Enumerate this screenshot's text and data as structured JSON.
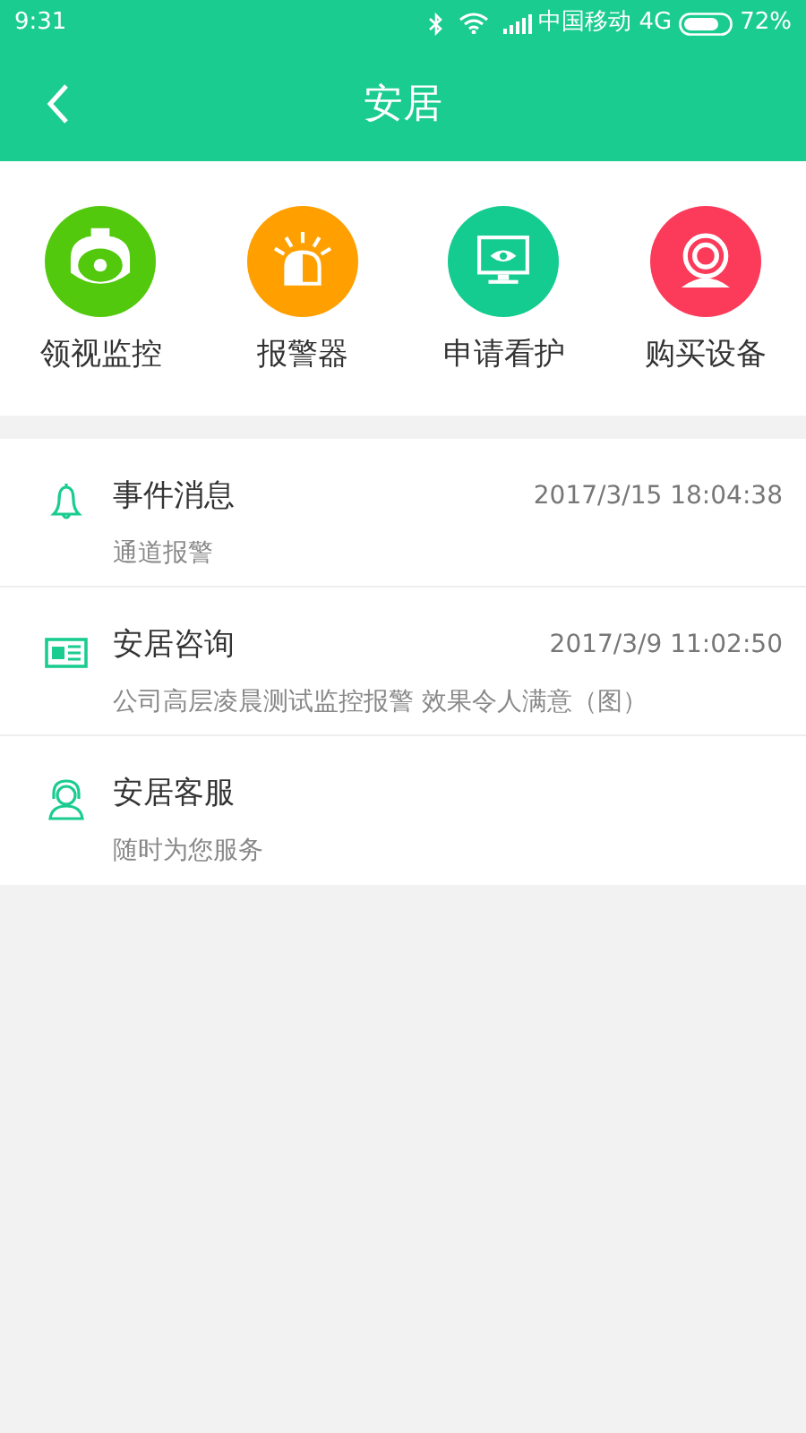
{
  "status_bar": {
    "time": "9:31",
    "carrier": "中国移动",
    "network": "4G",
    "battery": "72%"
  },
  "header": {
    "title": "安居"
  },
  "shortcuts": [
    {
      "kind": "camera",
      "label": "领视监控",
      "color": "#52c90c"
    },
    {
      "kind": "alarm",
      "label": "报警器",
      "color": "#ff9f00"
    },
    {
      "kind": "monitor",
      "label": "申请看护",
      "color": "#14cc8f"
    },
    {
      "kind": "webcam",
      "label": "购买设备",
      "color": "#fc3b5a"
    }
  ],
  "messages": [
    {
      "kind": "bell",
      "title": "事件消息",
      "time": "2017/3/15 18:04:38",
      "subtitle": "通道报警"
    },
    {
      "kind": "news",
      "title": "安居咨询",
      "time": "2017/3/9 11:02:50",
      "subtitle": "公司高层凌晨测试监控报警 效果令人满意（图）"
    },
    {
      "kind": "service",
      "title": "安居客服",
      "subtitle": "随时为您服务"
    }
  ]
}
